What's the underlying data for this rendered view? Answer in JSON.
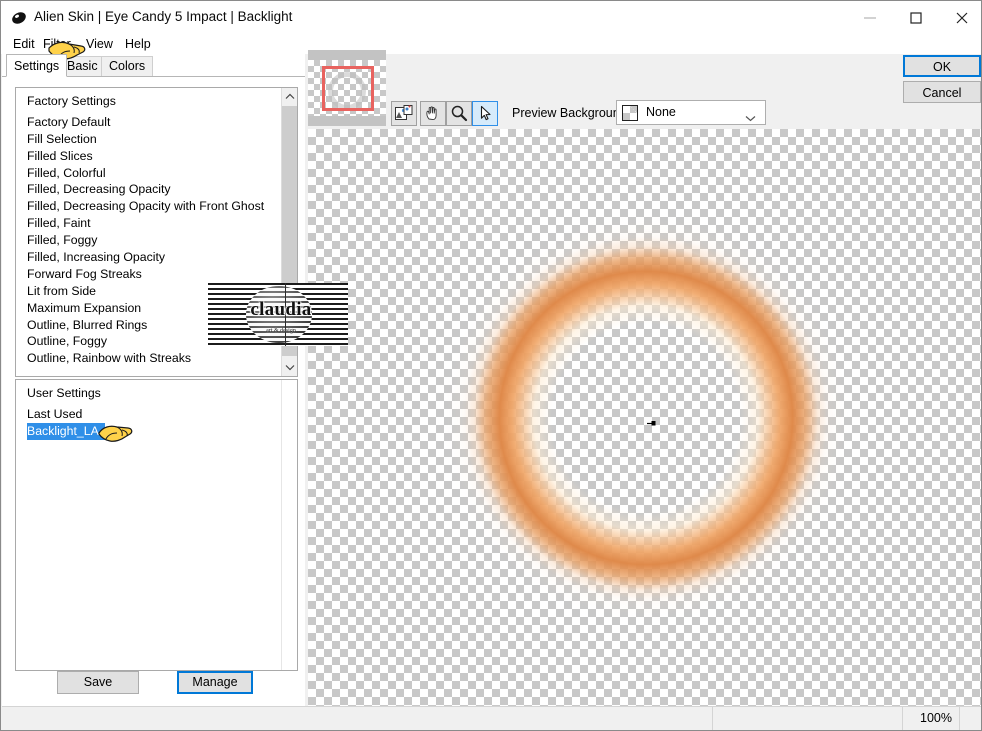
{
  "window": {
    "title": "Alien Skin | Eye Candy 5 Impact | Backlight",
    "app_icon": "alien-skin-icon",
    "minimize_label": "Minimize",
    "maximize_label": "Maximize",
    "close_label": "Close"
  },
  "menubar": {
    "items": [
      {
        "label": "Edit",
        "name": "menu-edit"
      },
      {
        "label": "Filter",
        "name": "menu-filter"
      },
      {
        "label": "View",
        "name": "menu-view"
      },
      {
        "label": "Help",
        "name": "menu-help"
      }
    ]
  },
  "tabs": [
    {
      "label": "Settings",
      "active": true
    },
    {
      "label": "Basic",
      "active": false
    },
    {
      "label": "Colors",
      "active": false
    }
  ],
  "factory_settings": {
    "header": "Factory Settings",
    "items": [
      "Factory Default",
      "Fill Selection",
      "Filled Slices",
      "Filled, Colorful",
      "Filled, Decreasing Opacity",
      "Filled, Decreasing Opacity with Front Ghost",
      "Filled, Faint",
      "Filled, Foggy",
      "Filled, Increasing Opacity",
      "Forward Fog Streaks",
      "Lit from Side",
      "Maximum Expansion",
      "Outline, Blurred Rings",
      "Outline, Foggy",
      "Outline, Rainbow with Streaks"
    ]
  },
  "user_settings": {
    "header": "User Settings",
    "items": [
      {
        "label": "Last Used",
        "selected": false
      },
      {
        "label": "Backlight_LA",
        "selected": true
      }
    ]
  },
  "preset_buttons": {
    "save_label": "Save",
    "manage_label": "Manage"
  },
  "preview_toolbar": {
    "tools": [
      {
        "name": "preview-image-tool",
        "icon": "image-preview-icon",
        "active": false
      },
      {
        "name": "pan-tool",
        "icon": "hand-icon",
        "active": false
      },
      {
        "name": "zoom-tool",
        "icon": "magnifier-icon",
        "active": false
      },
      {
        "name": "select-tool",
        "icon": "arrow-pointer-icon",
        "active": true
      }
    ],
    "background_label": "Preview Background:",
    "background_value": "None",
    "background_swatch": "checkerboard-swatch"
  },
  "dialog_buttons": {
    "ok_label": "OK",
    "cancel_label": "Cancel"
  },
  "statusbar": {
    "zoom": "100%"
  },
  "watermark": {
    "text": "claudia",
    "subtext": "art & design"
  },
  "colors": {
    "accent": "#0078d7",
    "selection": "#2f8fe8",
    "glow_orange": "#df8848",
    "glow_orange_light": "#f0a668",
    "crop_rect": "#e8635f",
    "checker_grey": "#c8c8c8",
    "panel_bg": "#f0f0f0",
    "button_bg": "#e1e1e1"
  },
  "preview": {
    "effect_name": "backlight-glow-ring",
    "center_marker": "center-crosshair-marker"
  }
}
